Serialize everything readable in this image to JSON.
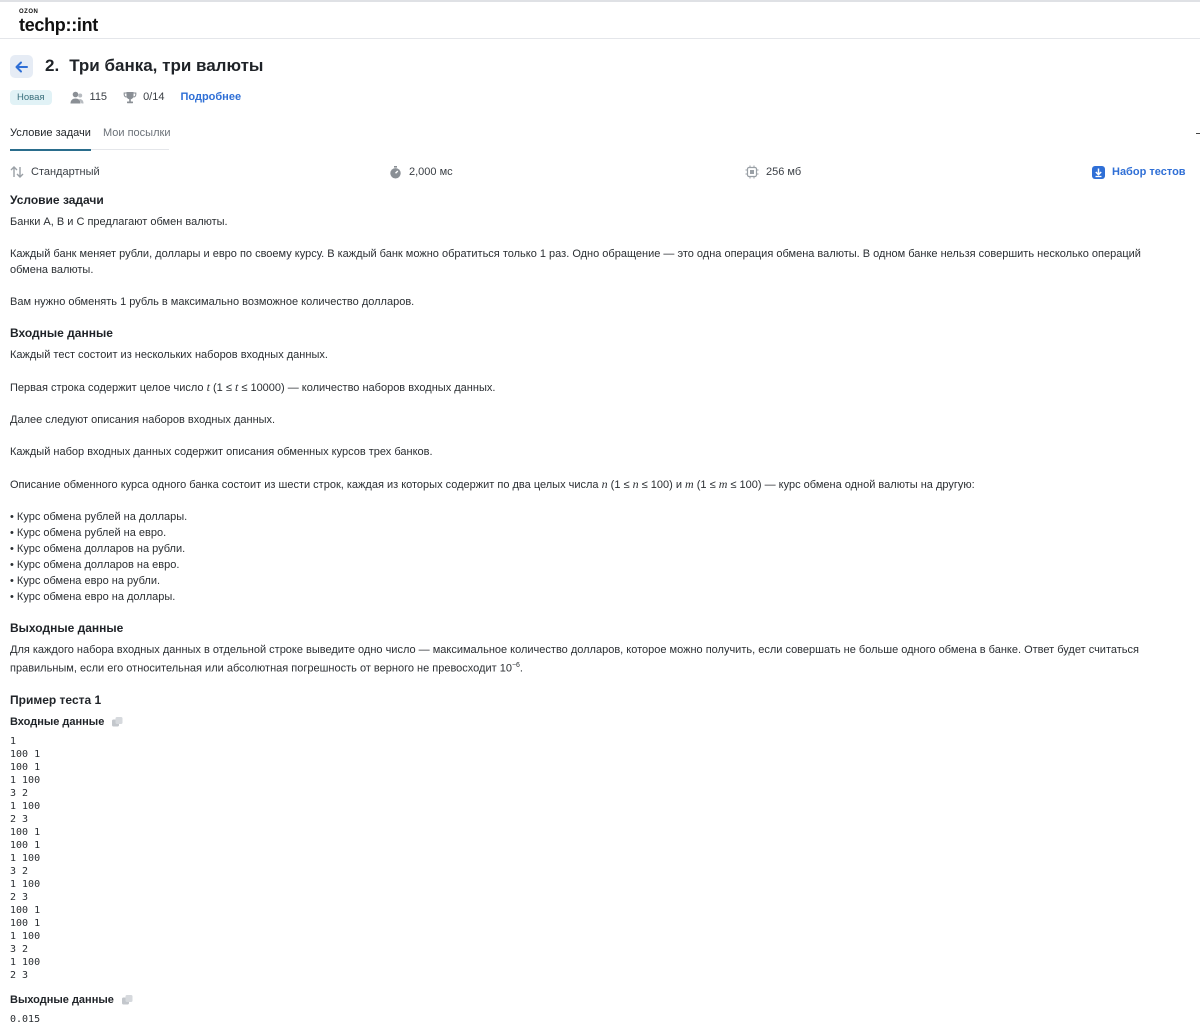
{
  "header": {
    "logo_top": "OZON",
    "logo_main": "techp::int"
  },
  "problem": {
    "number": "2.",
    "title": "Три банка, три валюты",
    "status_badge": "Новая",
    "solvers": "115",
    "score": "0/14",
    "more_link": "Подробнее"
  },
  "tabs": [
    {
      "label": "Условие задачи"
    },
    {
      "label": "Мои посылки"
    }
  ],
  "limits": {
    "io": "Стандартный",
    "time": "2,000 мс",
    "memory": "256 мб",
    "tests_link": "Набор тестов"
  },
  "statement": {
    "heading": "Условие задачи",
    "p1": "Банки A, B и C предлагают обмен валюты.",
    "p2": "Каждый банк меняет рубли, доллары и евро по своему курсу. В каждый банк можно обратиться только 1 раз. Одно обращение — это одна операция обмена валюты. В одном банке нельзя совершить несколько операций обмена валюты.",
    "p3": "Вам нужно обменять 1 рубль в максимально возможное количество долларов."
  },
  "input": {
    "heading": "Входные данные",
    "p1": "Каждый тест состоит из нескольких наборов входных данных.",
    "p2_a": "Первая строка содержит целое число ",
    "p2_var": "t",
    "p2_b": " (1 ≤ ",
    "p2_var2": "t",
    "p2_c": " ≤ 10000) — количество наборов входных данных.",
    "p3": "Далее следуют описания наборов входных данных.",
    "p4": "Каждый набор входных данных содержит описания обменных курсов трех банков.",
    "p5_a": "Описание обменного курса одного банка состоит из шести строк, каждая из которых содержит по два целых числа ",
    "p5_n": "n",
    "p5_b": " (1 ≤ ",
    "p5_n2": "n",
    "p5_c": " ≤ 100) и ",
    "p5_m": "m",
    "p5_d": " (1 ≤ ",
    "p5_m2": "m",
    "p5_e": " ≤ 100) — курс обмена одной валюты на другую:",
    "list": [
      "Курс обмена рублей на доллары.",
      "Курс обмена рублей на евро.",
      "Курс обмена долларов на рубли.",
      "Курс обмена долларов на евро.",
      "Курс обмена евро на рубли.",
      "Курс обмена евро на доллары."
    ]
  },
  "output": {
    "heading": "Выходные данные",
    "p1_a": "Для каждого набора входных данных в отдельной строке выведите одно число — максимальное количество долларов, которое можно получить, если совершать не больше одного обмена в банке. Ответ будет считаться правильным, если его относительная или абсолютная погрешность от верного не превосходит 10",
    "p1_sup": "−6",
    "p1_b": "."
  },
  "sample": {
    "heading": "Пример теста 1",
    "input_label": "Входные данные",
    "input_text": "1\n100 1\n100 1\n1 100\n3 2\n1 100\n2 3\n100 1\n100 1\n1 100\n3 2\n1 100\n2 3\n100 1\n100 1\n1 100\n3 2\n1 100\n2 3",
    "output_label": "Выходные данные",
    "output_text": "0.015"
  },
  "colors": {
    "link": "#2f6fd6",
    "badge_bg": "#e1f2f6",
    "tab_active": "#2a6d8c"
  }
}
